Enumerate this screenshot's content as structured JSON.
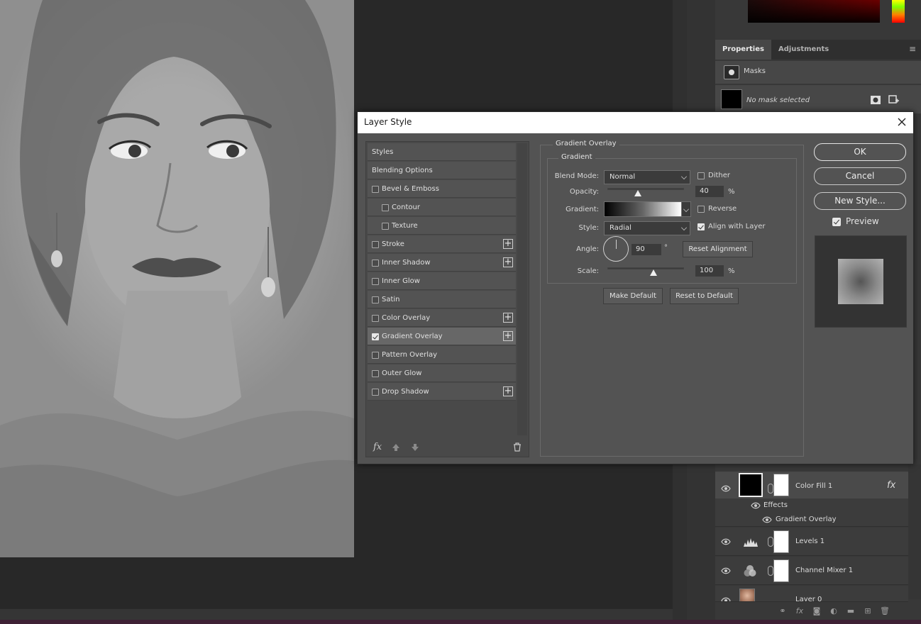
{
  "dialog": {
    "title": "Layer Style",
    "styles_list": [
      {
        "label": "Styles",
        "type": "header"
      },
      {
        "label": "Blending Options",
        "type": "header"
      },
      {
        "label": "Bevel & Emboss",
        "checked": false
      },
      {
        "label": "Contour",
        "checked": false,
        "indent": true
      },
      {
        "label": "Texture",
        "checked": false,
        "indent": true
      },
      {
        "label": "Stroke",
        "checked": false,
        "plus": true
      },
      {
        "label": "Inner Shadow",
        "checked": false,
        "plus": true
      },
      {
        "label": "Inner Glow",
        "checked": false
      },
      {
        "label": "Satin",
        "checked": false
      },
      {
        "label": "Color Overlay",
        "checked": false,
        "plus": true
      },
      {
        "label": "Gradient Overlay",
        "checked": true,
        "plus": true,
        "selected": true
      },
      {
        "label": "Pattern Overlay",
        "checked": false
      },
      {
        "label": "Outer Glow",
        "checked": false
      },
      {
        "label": "Drop Shadow",
        "checked": false,
        "plus": true
      }
    ],
    "footer_icons": [
      "fx-icon",
      "move-up-icon",
      "move-down-icon",
      "trash-icon"
    ],
    "footer_fx": "fx",
    "section_title": "Gradient Overlay",
    "subsection_title": "Gradient",
    "fields": {
      "blend_mode_label": "Blend Mode:",
      "blend_mode_value": "Normal",
      "dither_label": "Dither",
      "dither_checked": false,
      "opacity_label": "Opacity:",
      "opacity_value": "40",
      "opacity_unit": "%",
      "opacity_fraction": 0.4,
      "gradient_label": "Gradient:",
      "reverse_label": "Reverse",
      "reverse_checked": false,
      "style_label": "Style:",
      "style_value": "Radial",
      "align_label": "Align with Layer",
      "align_checked": true,
      "angle_label": "Angle:",
      "angle_value": "90",
      "angle_unit": "°",
      "reset_alignment": "Reset Alignment",
      "scale_label": "Scale:",
      "scale_value": "100",
      "scale_unit": "%",
      "scale_fraction": 0.6
    },
    "make_default": "Make Default",
    "reset_default": "Reset to Default",
    "buttons": {
      "ok": "OK",
      "cancel": "Cancel",
      "new_style": "New Style..."
    },
    "preview_label": "Preview",
    "preview_checked": true
  },
  "properties_panel": {
    "tabs": [
      "Properties",
      "Adjustments"
    ],
    "active_tab": "Properties",
    "masks_label": "Masks",
    "no_mask_label": "No mask selected"
  },
  "layers": [
    {
      "name": "Color Fill 1",
      "selected": true,
      "fx": "fx",
      "thumb": "black"
    },
    {
      "name": "Effects",
      "type": "effects"
    },
    {
      "name": "Gradient Overlay",
      "type": "effect-item"
    },
    {
      "name": "Levels 1",
      "thumb": "levels"
    },
    {
      "name": "Channel Mixer 1",
      "thumb": "mixer"
    },
    {
      "name": "Layer 0",
      "thumb": "photo"
    }
  ],
  "colors": {
    "dialog_bg": "#535353",
    "panel_bg": "#383838",
    "app_bg": "#282828",
    "accent_bottom": "#3e2135"
  }
}
